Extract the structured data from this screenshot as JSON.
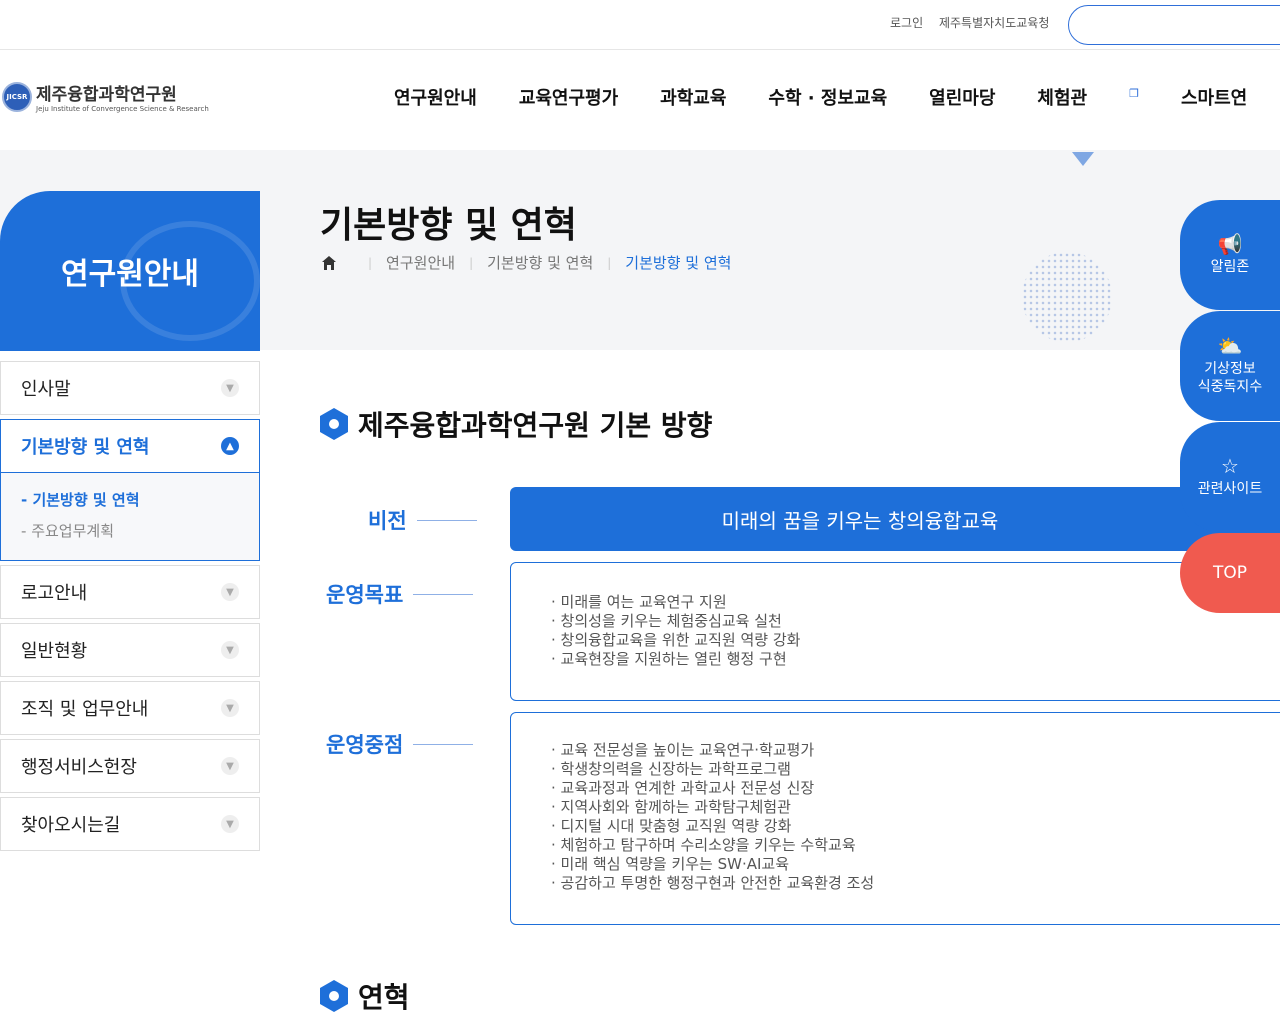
{
  "top": {
    "login": "로그인",
    "office": "제주특별자치도교육청"
  },
  "logo": {
    "mark": "JICSR",
    "kr": "제주융합과학연구원",
    "en": "Jeju Institute of Convergence Science & Research"
  },
  "nav": [
    "연구원안내",
    "교육연구평가",
    "과학교육",
    "수학 · 정보교육",
    "열린마당",
    "체험관",
    "스마트연"
  ],
  "side": {
    "title": "연구원안내"
  },
  "page": {
    "title": "기본방향 및 연혁"
  },
  "breadcrumb": [
    "연구원안내",
    "기본방향 및 연혁",
    "기본방향 및 연혁"
  ],
  "menu": {
    "items": [
      "인사말",
      "기본방향 및 연혁",
      "로고안내",
      "일반현황",
      "조직 및 업무안내",
      "행정서비스헌장",
      "찾아오시는길"
    ],
    "sub": [
      "기본방향 및 연혁",
      "주요업무계획"
    ]
  },
  "section1": {
    "title": "제주융합과학연구원 기본 방향"
  },
  "vision": {
    "label": "비전",
    "text": "미래의 꿈을 키우는 창의융합교육"
  },
  "goals": {
    "label": "운영목표",
    "items": [
      "미래를 여는 교육연구 지원",
      "창의성을 키우는 체험중심교육 실천",
      "창의융합교육을 위한 교직원 역량 강화",
      "교육현장을 지원하는 열린 행정 구현"
    ]
  },
  "focus": {
    "label": "운영중점",
    "items": [
      "교육 전문성을 높이는 교육연구·학교평가",
      "학생창의력을 신장하는 과학프로그램",
      "교육과정과 연계한 과학교사 전문성 신장",
      "지역사회와 함께하는 과학탐구체험관",
      "디지털 시대 맞춤형 교직원 역량 강화",
      "체험하고 탐구하며 수리소양을 키우는 수학교육",
      "미래 핵심 역량을 키우는 SW·AI교육",
      "공감하고 투명한 행정구현과 안전한 교육환경 조성"
    ]
  },
  "section2": {
    "title": "연혁"
  },
  "fabs": {
    "notice": "알림존",
    "weather1": "기상정보",
    "weather2": "식중독지수",
    "sites": "관련사이트",
    "top": "TOP"
  },
  "colors": {
    "primary": "#1e6fd9",
    "top_button": "#f05a4f"
  }
}
